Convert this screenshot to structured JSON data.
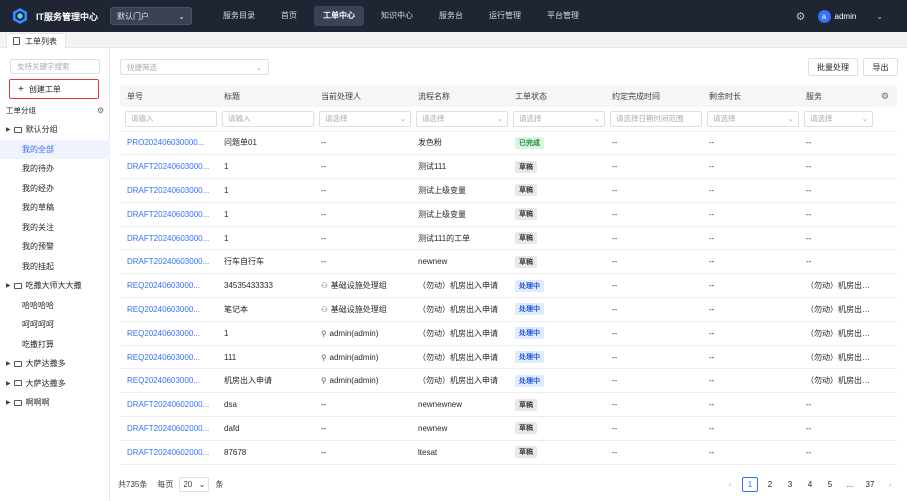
{
  "topbar": {
    "app_title": "IT服务管理中心",
    "portal_value": "默认门户",
    "nav": [
      "服务目录",
      "首页",
      "工单中心",
      "知识中心",
      "服务台",
      "运行管理",
      "平台管理"
    ],
    "active_nav_index": 2,
    "user_initial": "a",
    "user_name": "admin"
  },
  "tab": {
    "label": "工单列表"
  },
  "sidebar": {
    "search_placeholder": "支持关键字搜索",
    "create_label": "创建工单",
    "group_title": "工单分组",
    "tree": [
      {
        "type": "folder",
        "label": "默认分组"
      },
      {
        "type": "child",
        "label": "我的全部",
        "selected": true
      },
      {
        "type": "child",
        "label": "我的待办"
      },
      {
        "type": "child",
        "label": "我的经办"
      },
      {
        "type": "child",
        "label": "我的草稿"
      },
      {
        "type": "child",
        "label": "我的关注"
      },
      {
        "type": "child",
        "label": "我的预警"
      },
      {
        "type": "child",
        "label": "我的挂起"
      },
      {
        "type": "folder",
        "label": "吃撒大师大大撒"
      },
      {
        "type": "child",
        "label": "哈哈哈哈"
      },
      {
        "type": "child",
        "label": "呵呵呵呵"
      },
      {
        "type": "child",
        "label": "吃撒打算"
      },
      {
        "type": "folder",
        "label": "大萨达撒多"
      },
      {
        "type": "folder",
        "label": "大萨达撒多"
      },
      {
        "type": "folder",
        "label": "啊啊啊"
      }
    ]
  },
  "toolbar": {
    "filter_placeholder": "快捷筛选",
    "batch_label": "批量处理",
    "export_label": "导出"
  },
  "table": {
    "columns": [
      "单号",
      "标题",
      "当前处理人",
      "流程名称",
      "工单状态",
      "约定完成时间",
      "剩余时长",
      "服务"
    ],
    "filters": [
      "请输入",
      "请输入",
      "请选择",
      "请选择",
      "请选择",
      "请选择日期时间范围",
      "请选择",
      "请选择"
    ],
    "rows": [
      {
        "id": "PRO202406030000...",
        "title": "问题单01",
        "handler": "--",
        "handler_icon": "",
        "flow": "发色粉",
        "status": "已完成",
        "status_kind": "done",
        "due": "--",
        "remain": "--",
        "service": "--"
      },
      {
        "id": "DRAFT20240603000...",
        "title": "1",
        "handler": "--",
        "handler_icon": "",
        "flow": "测试111",
        "status": "草稿",
        "status_kind": "draft",
        "due": "--",
        "remain": "--",
        "service": "--"
      },
      {
        "id": "DRAFT20240603000...",
        "title": "1",
        "handler": "--",
        "handler_icon": "",
        "flow": "测试上级变量",
        "status": "草稿",
        "status_kind": "draft",
        "due": "--",
        "remain": "--",
        "service": "--"
      },
      {
        "id": "DRAFT20240603000...",
        "title": "1",
        "handler": "--",
        "handler_icon": "",
        "flow": "测试上级变量",
        "status": "草稿",
        "status_kind": "draft",
        "due": "--",
        "remain": "--",
        "service": "--"
      },
      {
        "id": "DRAFT20240603000...",
        "title": "1",
        "handler": "--",
        "handler_icon": "",
        "flow": "测试111的工单",
        "status": "草稿",
        "status_kind": "draft",
        "due": "--",
        "remain": "--",
        "service": "--"
      },
      {
        "id": "DRAFT20240603000...",
        "title": "行车自行车",
        "handler": "--",
        "handler_icon": "",
        "flow": "newnew",
        "status": "草稿",
        "status_kind": "draft",
        "due": "--",
        "remain": "--",
        "service": "--"
      },
      {
        "id": "REQ20240603000...",
        "title": "34535433333",
        "handler": "基础设施处理组",
        "handler_icon": "group",
        "flow": "（勿动）机房出入申请",
        "status": "处理中",
        "status_kind": "proc",
        "due": "--",
        "remain": "--",
        "service": "（勿动）机房出入申请"
      },
      {
        "id": "REQ20240603000...",
        "title": "笔记本",
        "handler": "基础设施处理组",
        "handler_icon": "group",
        "flow": "（勿动）机房出入申请",
        "status": "处理中",
        "status_kind": "proc",
        "due": "--",
        "remain": "--",
        "service": "（勿动）机房出入申请"
      },
      {
        "id": "REQ20240603000...",
        "title": "1",
        "handler": "admin(admin)",
        "handler_icon": "user",
        "flow": "（勿动）机房出入申请",
        "status": "处理中",
        "status_kind": "proc",
        "due": "--",
        "remain": "--",
        "service": "（勿动）机房出入申请"
      },
      {
        "id": "REQ20240603000...",
        "title": "111",
        "handler": "admin(admin)",
        "handler_icon": "user",
        "flow": "（勿动）机房出入申请",
        "status": "处理中",
        "status_kind": "proc",
        "due": "--",
        "remain": "--",
        "service": "（勿动）机房出入申请"
      },
      {
        "id": "REQ20240603000...",
        "title": "机房出入申请",
        "handler": "admin(admin)",
        "handler_icon": "user",
        "flow": "（勿动）机房出入申请",
        "status": "处理中",
        "status_kind": "proc",
        "due": "--",
        "remain": "--",
        "service": "（勿动）机房出入申请"
      },
      {
        "id": "DRAFT20240602000...",
        "title": "dsa",
        "handler": "--",
        "handler_icon": "",
        "flow": "newnewnew",
        "status": "草稿",
        "status_kind": "draft",
        "due": "--",
        "remain": "--",
        "service": "--"
      },
      {
        "id": "DRAFT20240602000...",
        "title": "dafd",
        "handler": "--",
        "handler_icon": "",
        "flow": "newnew",
        "status": "草稿",
        "status_kind": "draft",
        "due": "--",
        "remain": "--",
        "service": "--"
      },
      {
        "id": "DRAFT20240602000...",
        "title": "87678",
        "handler": "--",
        "handler_icon": "",
        "flow": "ltesat",
        "status": "草稿",
        "status_kind": "draft",
        "due": "--",
        "remain": "--",
        "service": "--"
      }
    ]
  },
  "pager": {
    "total": "共735条",
    "per_page_label": "每页",
    "per_page": "20",
    "unit": "条",
    "pages": [
      "1",
      "2",
      "3",
      "4",
      "5",
      "...",
      "37"
    ],
    "active_page": "1"
  },
  "colors": {
    "accent": "#3370ff",
    "topbar": "#1f2533",
    "create_highlight": "#e0393e"
  }
}
